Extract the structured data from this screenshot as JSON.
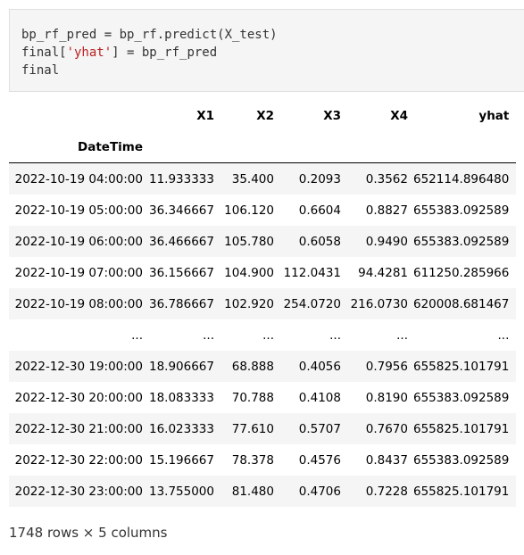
{
  "code": {
    "line1": "bp_rf_pred = bp_rf.predict(X_test)",
    "line2_prefix": "final[",
    "line2_string": "'yhat'",
    "line2_suffix": "] = bp_rf_pred",
    "line3": "final"
  },
  "table": {
    "columns": [
      "X1",
      "X2",
      "X3",
      "X4",
      "yhat"
    ],
    "index_name": "DateTime",
    "rows": [
      {
        "index": "2022-10-19 04:00:00",
        "cells": [
          "11.933333",
          "35.400",
          "0.2093",
          "0.3562",
          "652114.896480"
        ]
      },
      {
        "index": "2022-10-19 05:00:00",
        "cells": [
          "36.346667",
          "106.120",
          "0.6604",
          "0.8827",
          "655383.092589"
        ]
      },
      {
        "index": "2022-10-19 06:00:00",
        "cells": [
          "36.466667",
          "105.780",
          "0.6058",
          "0.9490",
          "655383.092589"
        ]
      },
      {
        "index": "2022-10-19 07:00:00",
        "cells": [
          "36.156667",
          "104.900",
          "112.0431",
          "94.4281",
          "611250.285966"
        ]
      },
      {
        "index": "2022-10-19 08:00:00",
        "cells": [
          "36.786667",
          "102.920",
          "254.0720",
          "216.0730",
          "620008.681467"
        ]
      },
      {
        "index": "...",
        "cells": [
          "...",
          "...",
          "...",
          "...",
          "..."
        ]
      },
      {
        "index": "2022-12-30 19:00:00",
        "cells": [
          "18.906667",
          "68.888",
          "0.4056",
          "0.7956",
          "655825.101791"
        ]
      },
      {
        "index": "2022-12-30 20:00:00",
        "cells": [
          "18.083333",
          "70.788",
          "0.4108",
          "0.8190",
          "655383.092589"
        ]
      },
      {
        "index": "2022-12-30 21:00:00",
        "cells": [
          "16.023333",
          "77.610",
          "0.5707",
          "0.7670",
          "655825.101791"
        ]
      },
      {
        "index": "2022-12-30 22:00:00",
        "cells": [
          "15.196667",
          "78.378",
          "0.4576",
          "0.8437",
          "655383.092589"
        ]
      },
      {
        "index": "2022-12-30 23:00:00",
        "cells": [
          "13.755000",
          "81.480",
          "0.4706",
          "0.7228",
          "655825.101791"
        ]
      }
    ]
  },
  "summary": "1748 rows × 5 columns",
  "colors": {
    "code_background": "#f5f5f5",
    "string_literal": "#ba2121",
    "row_stripe": "#f5f5f5"
  }
}
